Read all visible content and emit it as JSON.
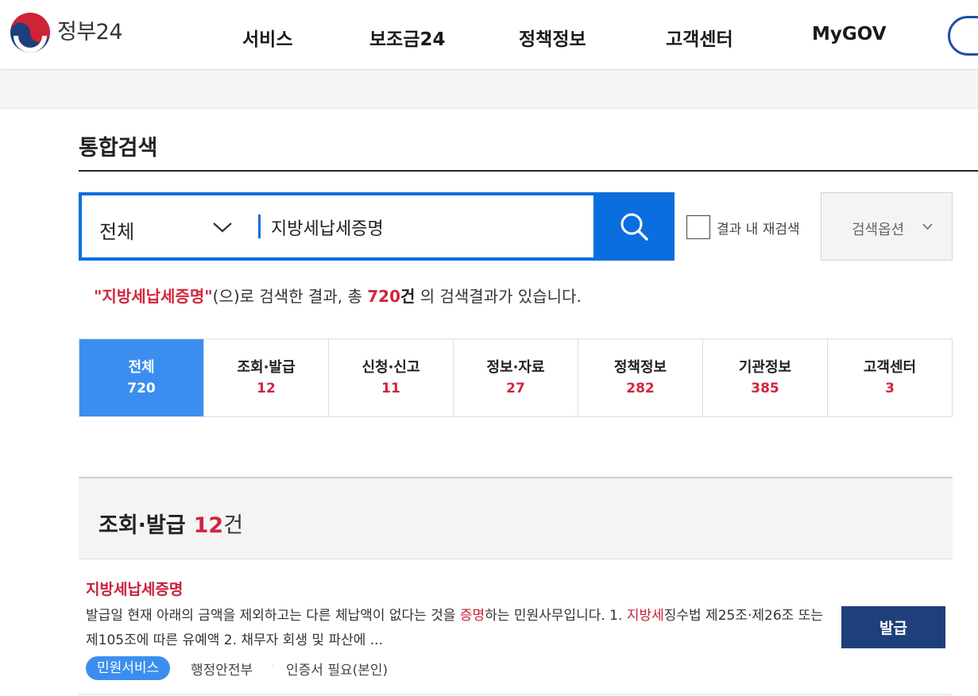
{
  "header": {
    "logo_text": "정부24",
    "nav": [
      "서비스",
      "보조금24",
      "정책정보",
      "고객센터",
      "MyGOV"
    ]
  },
  "page": {
    "title": "통합검색"
  },
  "search": {
    "scope": "전체",
    "query": "지방세납세증명",
    "recheck_label": "결과 내 재검색",
    "options_label": "검색옵션"
  },
  "summary": {
    "keyword": "\"지방세납세증명\"",
    "text1": "(으)로 검색한 결과, 총 ",
    "count": "720",
    "unit": "건",
    "text2": " 의 검색결과가 있습니다."
  },
  "tabs": [
    {
      "label": "전체",
      "count": "720",
      "active": true
    },
    {
      "label": "조회·발급",
      "count": "12"
    },
    {
      "label": "신청·신고",
      "count": "11"
    },
    {
      "label": "정보·자료",
      "count": "27"
    },
    {
      "label": "정책정보",
      "count": "282"
    },
    {
      "label": "기관정보",
      "count": "385"
    },
    {
      "label": "고객센터",
      "count": "3"
    }
  ],
  "section": {
    "title": "조회·발급",
    "count": "12",
    "unit": "건"
  },
  "result": {
    "title": "지방세납세증명",
    "desc_1": "발급일 현재 아래의 금액을 제외하고는 다른 체납액이 없다는 것을 ",
    "desc_hl1": "증명",
    "desc_2": "하는 민원사무입니다. 1. ",
    "desc_hl2": "지방세",
    "desc_3": "징수법 제25조·제26조 또는 제105조에 따른 유예액 2. 채무자 회생 및 파산에 ...",
    "badge": "민원서비스",
    "agency": "행정안전부",
    "separator": "·",
    "cert": "인증서 필요(본인)",
    "action_label": "발급"
  }
}
